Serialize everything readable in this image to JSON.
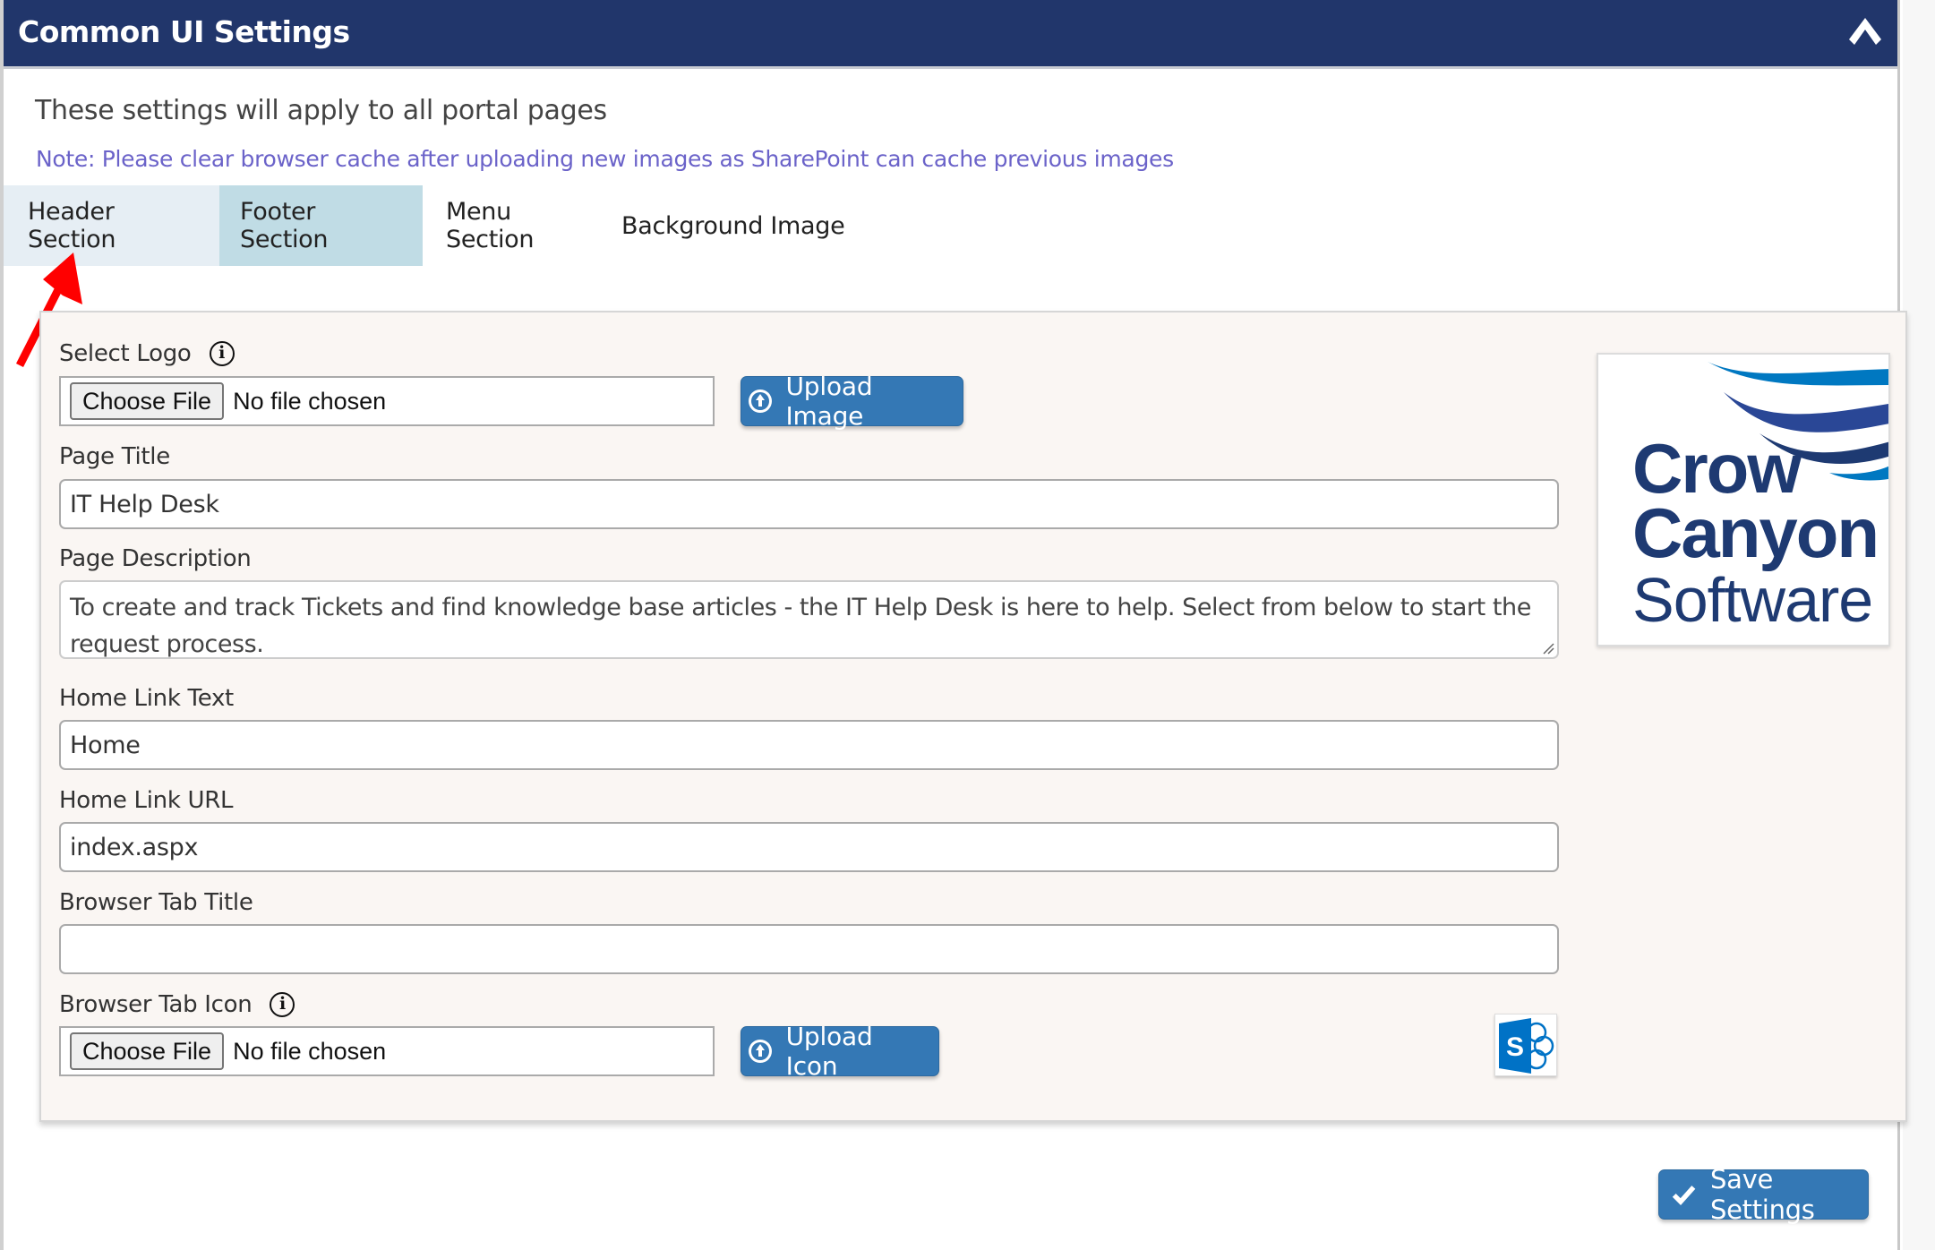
{
  "header": {
    "title": "Common UI Settings",
    "collapse_icon": "chevron-up-icon"
  },
  "intro": {
    "text": "These settings will apply to all portal pages",
    "note": "Note: Please clear browser cache after uploading new images as SharePoint can cache previous images"
  },
  "tabs": [
    {
      "label": "Header Section",
      "active": true
    },
    {
      "label": "Footer Section",
      "active": false
    },
    {
      "label": "Menu Section",
      "active": false
    },
    {
      "label": "Background Image",
      "active": false
    }
  ],
  "form": {
    "select_logo": {
      "label": "Select Logo",
      "choose_label": "Choose File",
      "status": "No file chosen",
      "upload_label": "Upload Image"
    },
    "page_title": {
      "label": "Page Title",
      "value": "IT Help Desk"
    },
    "page_description": {
      "label": "Page Description",
      "value": "To create and track Tickets and find knowledge base articles - the IT Help Desk is here to help. Select from below to start the request process."
    },
    "home_link_text": {
      "label": "Home Link Text",
      "value": "Home"
    },
    "home_link_url": {
      "label": "Home Link URL",
      "value": "index.aspx"
    },
    "browser_tab_title": {
      "label": "Browser Tab Title",
      "value": ""
    },
    "browser_tab_icon": {
      "label": "Browser Tab Icon",
      "choose_label": "Choose File",
      "status": "No file chosen",
      "upload_label": "Upload Icon"
    }
  },
  "logo_preview": {
    "line1": "Crow",
    "line2": "Canyon",
    "line3": "Software",
    "colors": {
      "text": "#1e3a72",
      "wave_light": "#0078c1",
      "wave_mid": "#2a4796",
      "wave_dark": "#1e3a72"
    }
  },
  "favicon_preview": {
    "letter": "S",
    "color": "#0072c6"
  },
  "footer": {
    "save_label": "Save Settings"
  },
  "colors": {
    "header_bg": "#21366b",
    "button_blue": "#3478b5",
    "note_text": "#6b63c9",
    "tab_active_bg": "#e6eef4",
    "tab_hover_bg": "#c0dce5",
    "annotation_arrow": "#ff0000"
  }
}
